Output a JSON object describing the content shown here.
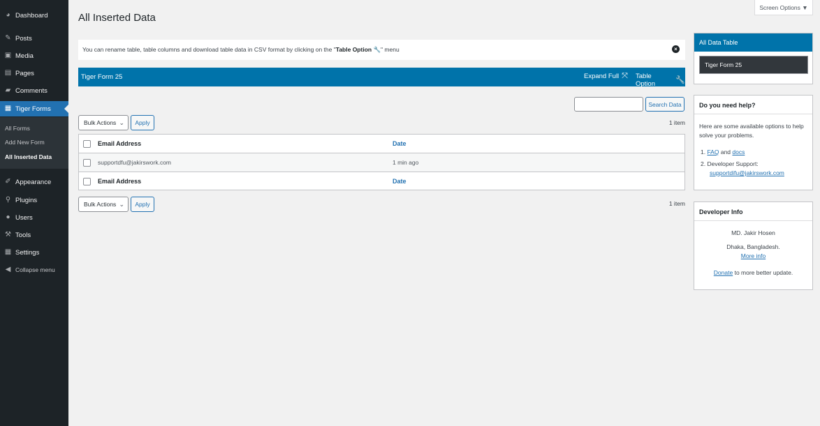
{
  "sidebar": {
    "items": [
      {
        "label": "Dashboard",
        "icon": "dashboard-icon"
      },
      {
        "label": "Posts",
        "icon": "pin-icon"
      },
      {
        "label": "Media",
        "icon": "media-icon"
      },
      {
        "label": "Pages",
        "icon": "pages-icon"
      },
      {
        "label": "Comments",
        "icon": "comment-icon"
      },
      {
        "label": "Tiger Forms",
        "icon": "form-icon"
      },
      {
        "label": "Appearance",
        "icon": "brush-icon"
      },
      {
        "label": "Plugins",
        "icon": "plugin-icon"
      },
      {
        "label": "Users",
        "icon": "user-icon"
      },
      {
        "label": "Tools",
        "icon": "wrench-icon"
      },
      {
        "label": "Settings",
        "icon": "settings-icon"
      },
      {
        "label": "Collapse menu",
        "icon": "collapse-icon"
      }
    ],
    "submenu": [
      "All Forms",
      "Add New Form",
      "All Inserted Data"
    ]
  },
  "header": {
    "title": "All Inserted Data",
    "screen_options": "Screen Options ▼"
  },
  "notice": {
    "text_before": "You can rename table, table columns and download table data in CSV format by clicking on the \"",
    "bold": "Table Option",
    "text_after": "\" menu"
  },
  "form_bar": {
    "name": "Tiger Form 25",
    "expand_full": "Expand Full",
    "table_option": "Table Option"
  },
  "search": {
    "placeholder": "",
    "button": "Search Data"
  },
  "bulk": {
    "select_label": "Bulk Actions",
    "apply": "Apply",
    "count": "1 item"
  },
  "table": {
    "columns": [
      "Email Address",
      "Date"
    ],
    "rows": [
      {
        "email": "supportdfu@jakirswork.com",
        "date": "1 min ago"
      }
    ]
  },
  "panels": {
    "all_data": {
      "title": "All Data Table",
      "item": "Tiger Form 25"
    },
    "help": {
      "title": "Do you need help?",
      "intro": "Here are some available options to help solve your problems.",
      "faq": "FAQ",
      "and": "and",
      "docs": "docs",
      "dev_support": "Developer Support:",
      "email": "supportdifu@jakirswork.com"
    },
    "dev": {
      "title": "Developer Info",
      "name": "MD. Jakir Hosen",
      "location": "Dhaka, Bangladesh.",
      "more": "More info",
      "donate": "Donate",
      "donate_suffix": "to more better update."
    }
  },
  "colors": {
    "sidebar": "#1d2327",
    "accent": "#0073aa",
    "link": "#2271b1"
  }
}
